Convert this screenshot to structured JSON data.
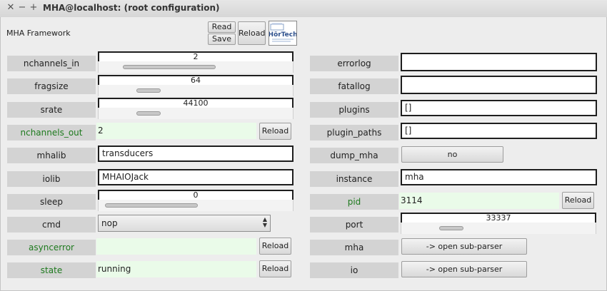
{
  "window": {
    "title": "MHA@localhost: (root configuration)"
  },
  "header": {
    "framework_label": "MHA Framework",
    "read_label": "Read",
    "save_label": "Save",
    "reload_label": "Reload"
  },
  "logo": {
    "text": "HörTech"
  },
  "left": {
    "nchannels_in": {
      "label": "nchannels_in",
      "value": "2",
      "level": 0.38
    },
    "fragsize": {
      "label": "fragsize",
      "value": "64",
      "level": 0.2
    },
    "srate": {
      "label": "srate",
      "value": "44100",
      "level": 0.2
    },
    "nchannels_out": {
      "label": "nchannels_out",
      "value": "2",
      "reload": "Reload"
    },
    "mhalib": {
      "label": "mhalib",
      "value": "transducers"
    },
    "iolib": {
      "label": "iolib",
      "value": "MHAIOJack"
    },
    "sleep": {
      "label": "sleep",
      "value": "0",
      "level": 0.0
    },
    "cmd": {
      "label": "cmd",
      "value": "nop"
    },
    "asyncerror": {
      "label": "asyncerror",
      "value": "",
      "reload": "Reload"
    },
    "state": {
      "label": "state",
      "value": "running",
      "reload": "Reload"
    }
  },
  "right": {
    "errorlog": {
      "label": "errorlog",
      "value": ""
    },
    "fatallog": {
      "label": "fatallog",
      "value": ""
    },
    "plugins": {
      "label": "plugins",
      "value": "[]"
    },
    "plugin_paths": {
      "label": "plugin_paths",
      "value": "[]"
    },
    "dump_mha": {
      "label": "dump_mha",
      "value": "no"
    },
    "instance": {
      "label": "instance",
      "value": "mha"
    },
    "pid": {
      "label": "pid",
      "value": "3114",
      "reload": "Reload"
    },
    "port": {
      "label": "port",
      "value": "33337",
      "level": 0.22
    },
    "mha": {
      "label": "mha",
      "value": "-> open sub-parser"
    },
    "io": {
      "label": "io",
      "value": "-> open sub-parser"
    }
  }
}
